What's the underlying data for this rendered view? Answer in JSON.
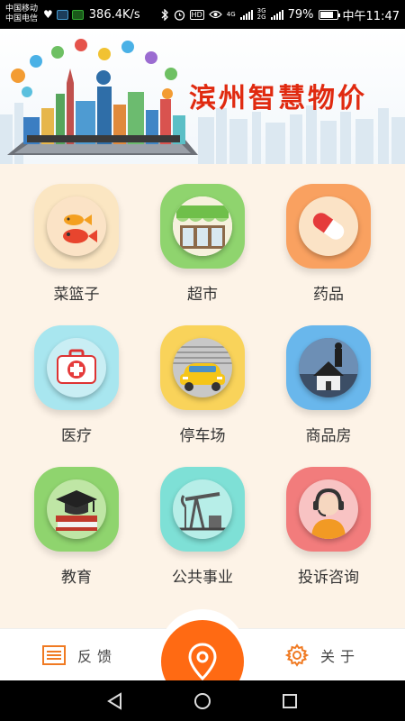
{
  "status_bar": {
    "carrier_1": "中国移动",
    "carrier_2": "中国电信",
    "net_speed": "386.4K/s",
    "hd_badge": "HD",
    "network_type": "4G",
    "network_type_2": "3G 2G",
    "battery_percent": "79%",
    "battery_level": 0.79,
    "time": "中午11:47",
    "icons": [
      "heart-rate-icon",
      "app-notification-icon",
      "app-notification-icon",
      "bluetooth-icon",
      "alarm-icon",
      "hd-icon",
      "eye-icon",
      "signal-icon",
      "battery-icon"
    ]
  },
  "banner": {
    "title": "滨州智慧物价"
  },
  "categories": [
    {
      "label": "菜篮子",
      "icon": "fish-icon",
      "tile_color": "#fbe6c2"
    },
    {
      "label": "超市",
      "icon": "supermarket-icon",
      "tile_color": "#8fd46e"
    },
    {
      "label": "药品",
      "icon": "pill-icon",
      "tile_color": "#f9a160"
    },
    {
      "label": "医疗",
      "icon": "first-aid-kit-icon",
      "tile_color": "#a8e6ef"
    },
    {
      "label": "停车场",
      "icon": "car-icon",
      "tile_color": "#f9d35a"
    },
    {
      "label": "商品房",
      "icon": "house-icon",
      "tile_color": "#69b7ec"
    },
    {
      "label": "教育",
      "icon": "graduation-cap-icon",
      "tile_color": "#8fd46e"
    },
    {
      "label": "公共事业",
      "icon": "oil-pump-icon",
      "tile_color": "#7ee0d6"
    },
    {
      "label": "投诉咨询",
      "icon": "customer-service-icon",
      "tile_color": "#f27c7c"
    }
  ],
  "bottom_nav": {
    "feedback_label": "反馈",
    "feedback_icon": "list-icon",
    "location_icon": "location-pin-icon",
    "about_label": "关于",
    "about_icon": "gear-icon",
    "accent_color": "#ff6a13"
  },
  "system_nav": [
    "back-icon",
    "home-icon",
    "recents-icon"
  ]
}
